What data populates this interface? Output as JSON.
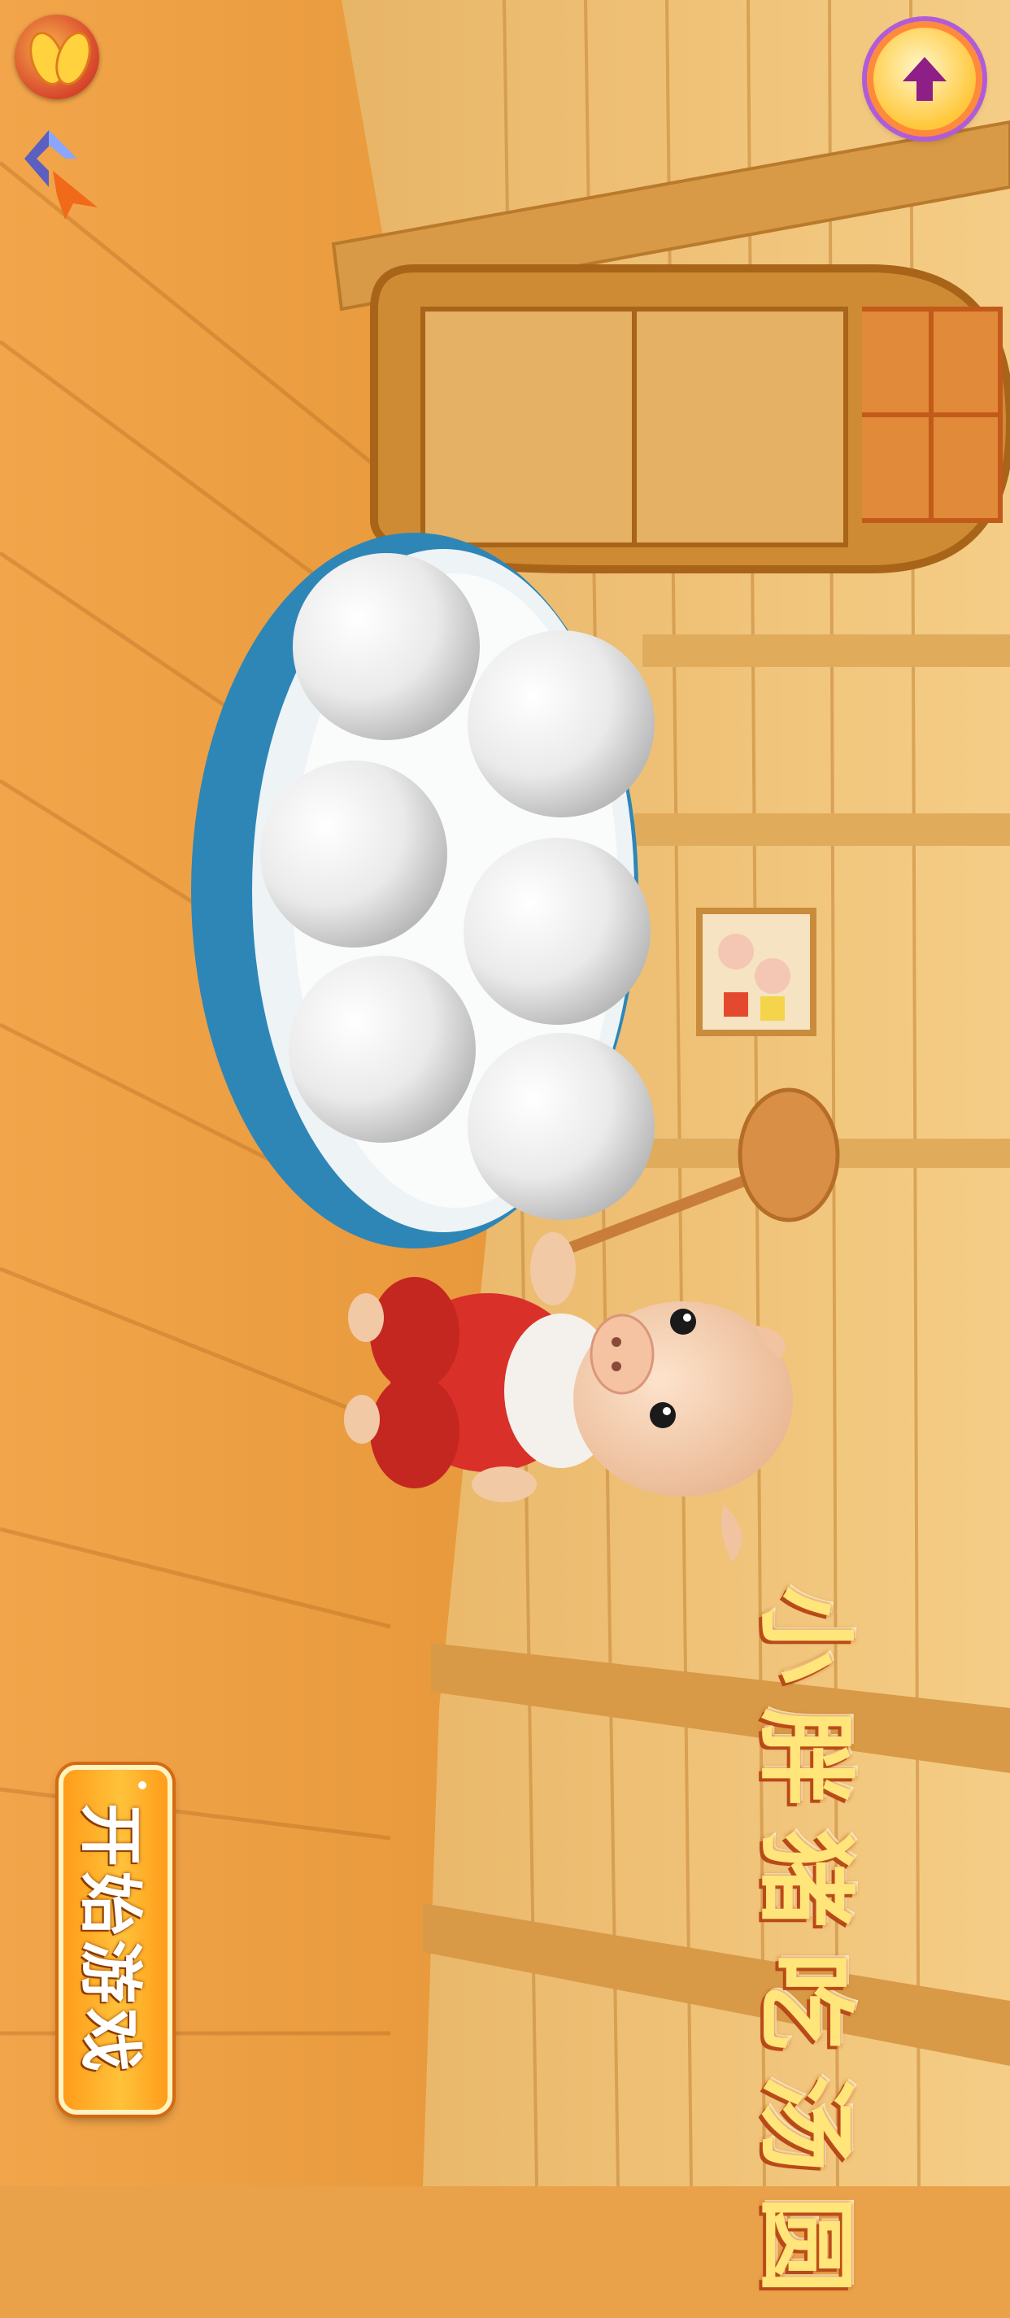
{
  "app": {
    "title": "小胖猪吃汤圆",
    "start_button_label": "开始游戏"
  },
  "icons": {
    "top_left_badge": "fish-badge-icon",
    "brand_logo": "brand-logo-icon",
    "top_right_button": "arrow-up-icon"
  },
  "scene": {
    "bowl_item_count": 6,
    "items": [
      "tangyuan-ball",
      "tangyuan-ball",
      "tangyuan-ball",
      "tangyuan-ball",
      "tangyuan-ball",
      "tangyuan-ball"
    ]
  },
  "colors": {
    "accent_orange": "#ffb020",
    "title_yellow": "#ffe57a",
    "button_purple_ring": "#b05cd8",
    "arrow_purple": "#8e1f86",
    "bowl_blue": "#2e86b7",
    "wood": "#e9a24a"
  }
}
